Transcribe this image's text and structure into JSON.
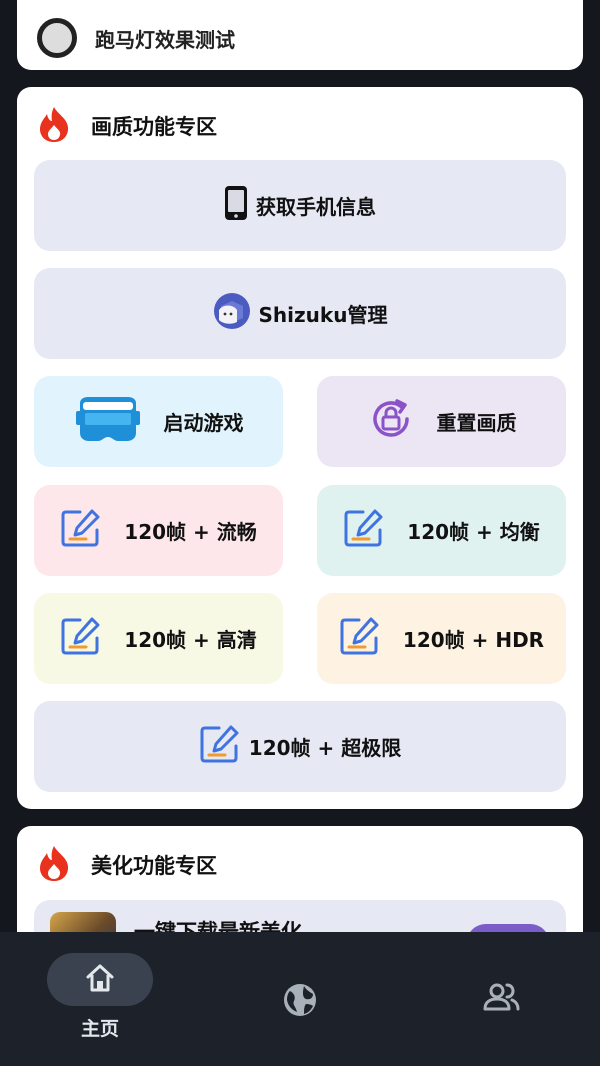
{
  "top_card": {
    "label": "跑马灯效果测试"
  },
  "quality": {
    "title": "画质功能专区",
    "phone_info": "获取手机信息",
    "shizuku": "Shizuku管理",
    "launch_game": "启动游戏",
    "reset_quality": "重置画质",
    "fps_smooth": "120帧 + 流畅",
    "fps_balanced": "120帧 + 均衡",
    "fps_hd": "120帧 + 高清",
    "fps_hdr": "120帧 + HDR",
    "fps_extreme": "120帧 + 超极限"
  },
  "beauty": {
    "title": "美化功能专区",
    "download_latest": "一键下载最新美化"
  },
  "nav": {
    "home_label": "主页",
    "icons": [
      "home-icon",
      "globe-icon",
      "people-icon"
    ]
  },
  "colors": {
    "background": "#14181e",
    "card": "#ffffff",
    "navbar": "#1d222a",
    "nav_active": "#3a4250",
    "flame": "#e8321e",
    "edit_icon_blue": "#3f74e0",
    "edit_icon_orange": "#f29a2e"
  }
}
